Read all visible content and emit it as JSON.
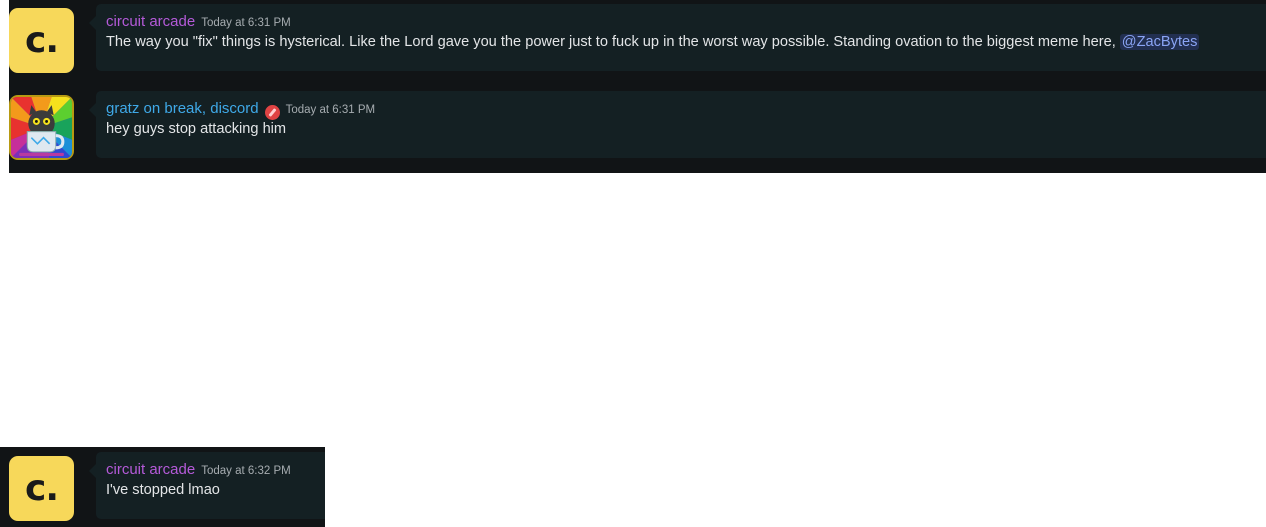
{
  "messages": [
    {
      "author": "circuit arcade",
      "author_color": "#b45ad8",
      "avatar_letter": "c.",
      "timestamp": "Today at 6:31 PM",
      "text": "The way you \"fix\" things is hysterical. Like the Lord gave you the power just to fuck up in the worst way possible. Standing ovation to the biggest meme here,",
      "mention": "@ZacBytes"
    },
    {
      "author": "gratz on break, discord",
      "author_color": "#3fa9e8",
      "avatar_icon": "cat-mug-icon",
      "badge_icon": "pencil-badge-icon",
      "timestamp": "Today at 6:31 PM",
      "text": "hey guys stop attacking him"
    },
    {
      "author": "circuit arcade",
      "author_color": "#b45ad8",
      "avatar_letter": "c.",
      "timestamp": "Today at 6:32 PM",
      "text": "I've stopped lmao"
    }
  ],
  "colors": {
    "panel_bg": "#111416",
    "bubble_bg": "#142023",
    "text": "#e3e5e7",
    "timestamp": "#a6acb0",
    "mention": "#8aa4f4",
    "avatar_yellow": "#f7d85a"
  }
}
